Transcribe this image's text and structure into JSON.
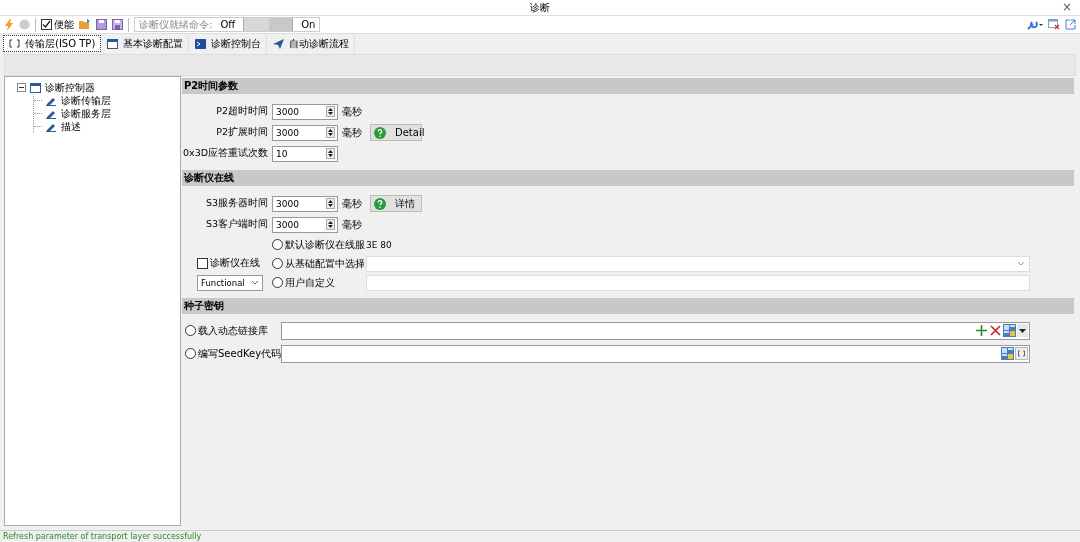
{
  "window": {
    "title": "诊断",
    "close": "×"
  },
  "toolbar": {
    "enable": {
      "label": "便能",
      "checked": true
    },
    "ready_label": "诊断仪就绪命令:",
    "off": "Off",
    "on": "On",
    "switch_on": false
  },
  "tabs": [
    {
      "label": "传输层(ISO TP)",
      "selected": true
    },
    {
      "label": "基本诊断配置",
      "selected": false
    },
    {
      "label": "诊断控制台",
      "selected": false
    },
    {
      "label": "自动诊断流程",
      "selected": false
    }
  ],
  "tree": {
    "label": "诊断控制器",
    "expanded": true,
    "children": [
      {
        "label": "诊断传输层"
      },
      {
        "label": "诊断服务层"
      },
      {
        "label": "描述"
      }
    ]
  },
  "p2": {
    "title": "P2时间参数",
    "rows": [
      {
        "label": "P2超时时间",
        "value": "3000",
        "unit": "毫秒"
      },
      {
        "label": "P2扩展时间",
        "value": "3000",
        "unit": "毫秒",
        "button": "Detail"
      },
      {
        "label": "0x3D应答重试次数",
        "value": "10"
      }
    ]
  },
  "online": {
    "title": "诊断仪在线",
    "rows": [
      {
        "label": "S3服务器时间",
        "value": "3000",
        "unit": "毫秒",
        "button": "详情"
      },
      {
        "label": "S3客户端时间",
        "value": "3000",
        "unit": "毫秒"
      }
    ],
    "enable": {
      "label": "诊断仪在线",
      "checked": false
    },
    "mode": "Functional",
    "options": [
      {
        "label": "默认诊断仪在线服",
        "selected": false,
        "kind": "text",
        "value": "3E 80"
      },
      {
        "label": "从基础配置中选择",
        "selected": false,
        "kind": "dropdown"
      },
      {
        "label": "用户自定义",
        "selected": false,
        "kind": "input"
      }
    ]
  },
  "seed": {
    "title": "种子密钥",
    "options": [
      {
        "label": "载入动态链接库",
        "selected": false,
        "kind": "library"
      },
      {
        "label": "编写SeedKey代码",
        "selected": false,
        "kind": "code"
      }
    ]
  },
  "status_bar": {
    "message": "Refresh parameter of transport layer successfully"
  }
}
